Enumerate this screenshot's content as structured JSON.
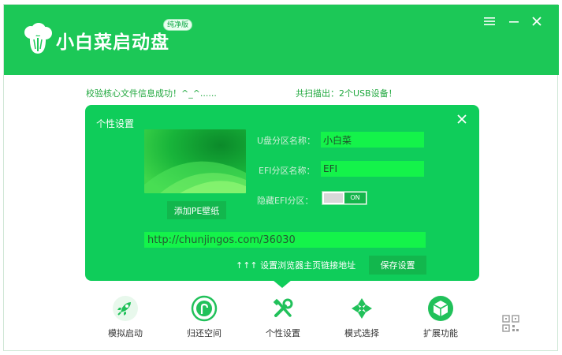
{
  "app": {
    "title": "小白菜启动盘",
    "edition_badge": "纯净版"
  },
  "window_controls": {
    "menu_icon": "menu-icon",
    "minimize_icon": "minimize-icon",
    "close_icon": "close-icon"
  },
  "status": {
    "left": "校验核心文件信息成功！^_^......",
    "right": "共扫描出：2个USB设备！"
  },
  "dialog": {
    "title": "个性设置",
    "add_wallpaper_label": "添加PE壁纸",
    "fields": {
      "u_partition_label": "U盘分区名称：",
      "u_partition_value": "小白菜",
      "efi_partition_label": "EFI分区名称：",
      "efi_partition_value": "EFI",
      "hide_efi_label": "隐藏EFI分区：",
      "hide_efi_state": "ON"
    },
    "homepage_url": "http://chunjingos.com/36030",
    "homepage_hint": "↑↑↑ 设置浏览器主页链接地址",
    "save_label": "保存设置"
  },
  "toolbar": [
    {
      "label": "模拟启动",
      "icon": "rocket-icon"
    },
    {
      "label": "归还空间",
      "icon": "restore-space-icon"
    },
    {
      "label": "个性设置",
      "icon": "tools-icon"
    },
    {
      "label": "模式选择",
      "icon": "mode-grid-icon"
    },
    {
      "label": "扩展功能",
      "icon": "cube-icon"
    }
  ],
  "colors": {
    "brand_green": "#1cc857",
    "dialog_green": "#0fcd5a",
    "input_green": "#14f34a",
    "button_green": "#12b74d"
  }
}
